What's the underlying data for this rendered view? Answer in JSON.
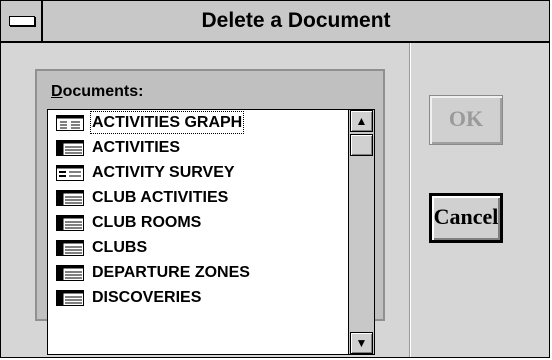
{
  "window": {
    "title": "Delete a Document"
  },
  "documents": {
    "label_mnemonic": "D",
    "label_rest": "ocuments:",
    "items": [
      {
        "label": "ACTIVITIES GRAPH",
        "icon": "graph-document-icon"
      },
      {
        "label": "ACTIVITIES",
        "icon": "table-document-icon"
      },
      {
        "label": "ACTIVITY SURVEY",
        "icon": "form-document-icon"
      },
      {
        "label": "CLUB ACTIVITIES",
        "icon": "table-document-icon"
      },
      {
        "label": "CLUB ROOMS",
        "icon": "table-document-icon"
      },
      {
        "label": "CLUBS",
        "icon": "table-document-icon"
      },
      {
        "label": "DEPARTURE ZONES",
        "icon": "table-document-icon"
      },
      {
        "label": "DISCOVERIES",
        "icon": "table-document-icon"
      }
    ],
    "scroll_up_glyph": "▲",
    "scroll_down_glyph": "▼"
  },
  "buttons": {
    "ok_label": "OK",
    "cancel_label": "Cancel"
  },
  "colors": {
    "dialog_bg": "#d6d6d6",
    "disabled_text": "#9a9a9a"
  }
}
